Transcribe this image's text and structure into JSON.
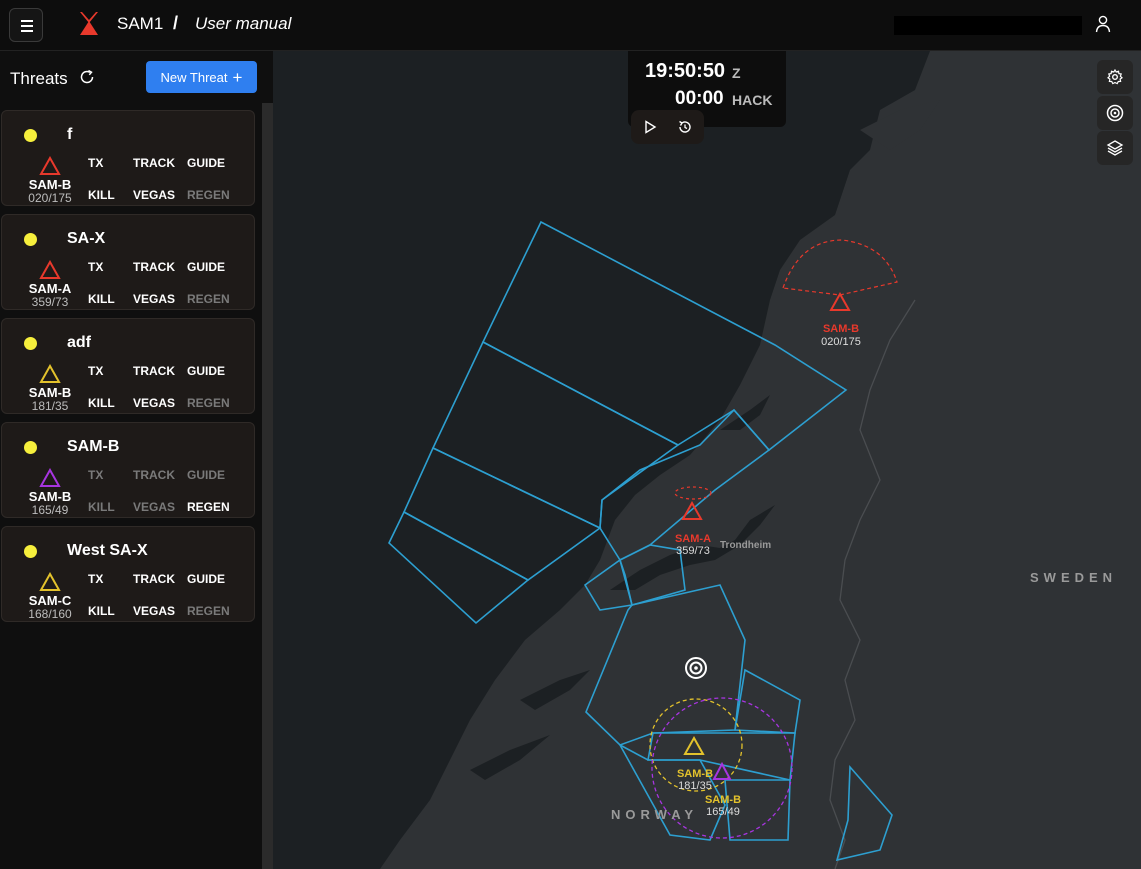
{
  "header": {
    "app_name": "SAM1",
    "separator": "/",
    "page_title": "User manual"
  },
  "sidebar": {
    "title": "Threats",
    "new_threat_label": "New Threat",
    "threats": [
      {
        "name": "f",
        "type": "SAM-B",
        "bearing": "020/175",
        "symbol_color": "#e8392c",
        "states": {
          "tx": "TX",
          "track": "TRACK",
          "guide": "GUIDE",
          "kill": "KILL",
          "vegas": "VEGAS",
          "regen": "REGEN"
        }
      },
      {
        "name": "SA-X",
        "type": "SAM-A",
        "bearing": "359/73",
        "symbol_color": "#e8392c",
        "states": {
          "tx": "TX",
          "track": "TRACK",
          "guide": "GUIDE",
          "kill": "KILL",
          "vegas": "VEGAS",
          "regen": "REGEN"
        }
      },
      {
        "name": "adf",
        "type": "SAM-B",
        "bearing": "181/35",
        "symbol_color": "#e3c22c",
        "states": {
          "tx": "TX",
          "track": "TRACK",
          "guide": "GUIDE",
          "kill": "KILL",
          "vegas": "VEGAS",
          "regen": "REGEN"
        }
      },
      {
        "name": "SAM-B",
        "type": "SAM-B",
        "bearing": "165/49",
        "symbol_color": "#a735e0",
        "states": {
          "tx": "TX",
          "track": "TRACK",
          "guide": "GUIDE",
          "kill": "KILL",
          "vegas": "VEGAS",
          "regen": "REGEN"
        }
      },
      {
        "name": "West SA-X",
        "type": "SAM-C",
        "bearing": "168/160",
        "symbol_color": "#e3c22c",
        "states": {
          "tx": "TX",
          "track": "TRACK",
          "guide": "GUIDE",
          "kill": "KILL",
          "vegas": "VEGAS",
          "regen": "REGEN"
        }
      }
    ]
  },
  "clock": {
    "time": "19:50:50",
    "zone": "Z",
    "hack_time": "00:00",
    "hack_label": "HACK"
  },
  "map": {
    "city": "Trondheim",
    "countries": {
      "sweden": "SWEDEN",
      "norway": "NORWAY"
    },
    "markers": [
      {
        "type": "SAM-B",
        "bearing": "020/175",
        "color": "#e8392c"
      },
      {
        "type": "SAM-A",
        "bearing": "359/73",
        "color": "#e8392c"
      },
      {
        "type": "SAM-B",
        "bearing": "181/35",
        "color": "#e3c22c"
      },
      {
        "type": "SAM-B",
        "bearing": "165/49",
        "color": "#e3c22c"
      }
    ]
  },
  "colors": {
    "accent": "#2f7ff0",
    "zone_lines": "#2d9fd0",
    "active_dot": "#f6ef3c"
  }
}
